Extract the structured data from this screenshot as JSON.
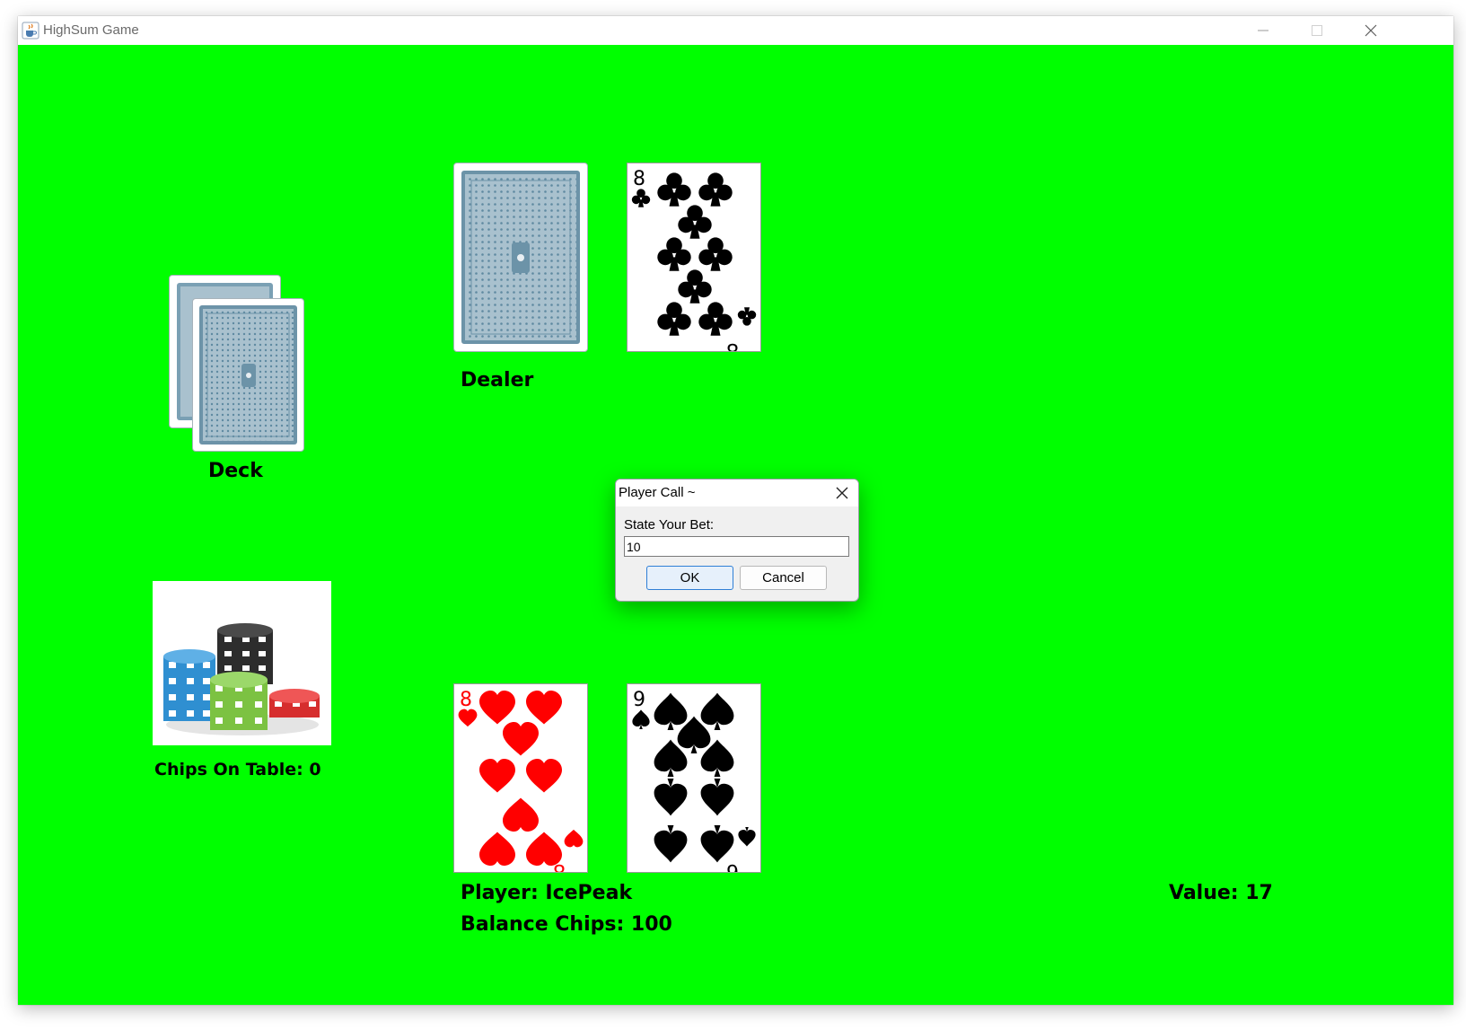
{
  "window": {
    "title": "HighSum Game",
    "icon": "java-cup-icon",
    "controls": [
      "minimize-icon",
      "maximize-icon",
      "close-icon"
    ]
  },
  "table": {
    "background": "#00ff00",
    "deck": {
      "label": "Deck"
    },
    "dealer": {
      "label": "Dealer",
      "cards": [
        {
          "face": "down"
        },
        {
          "face": "up",
          "rank": "8",
          "suit": "clubs",
          "color": "#000000"
        }
      ]
    },
    "chips": {
      "label": "Chips On Table: 0"
    },
    "player": {
      "name_label": "Player: IcePeak",
      "balance_label": "Balance Chips: 100",
      "value_label": "Value: 17",
      "cards": [
        {
          "face": "up",
          "rank": "8",
          "suit": "hearts",
          "color": "#ff0000"
        },
        {
          "face": "up",
          "rank": "9",
          "suit": "spades",
          "color": "#000000"
        }
      ]
    }
  },
  "dialog": {
    "title": "Player Call ~",
    "prompt": "State Your Bet:",
    "input_value": "10",
    "ok_label": "OK",
    "cancel_label": "Cancel"
  }
}
